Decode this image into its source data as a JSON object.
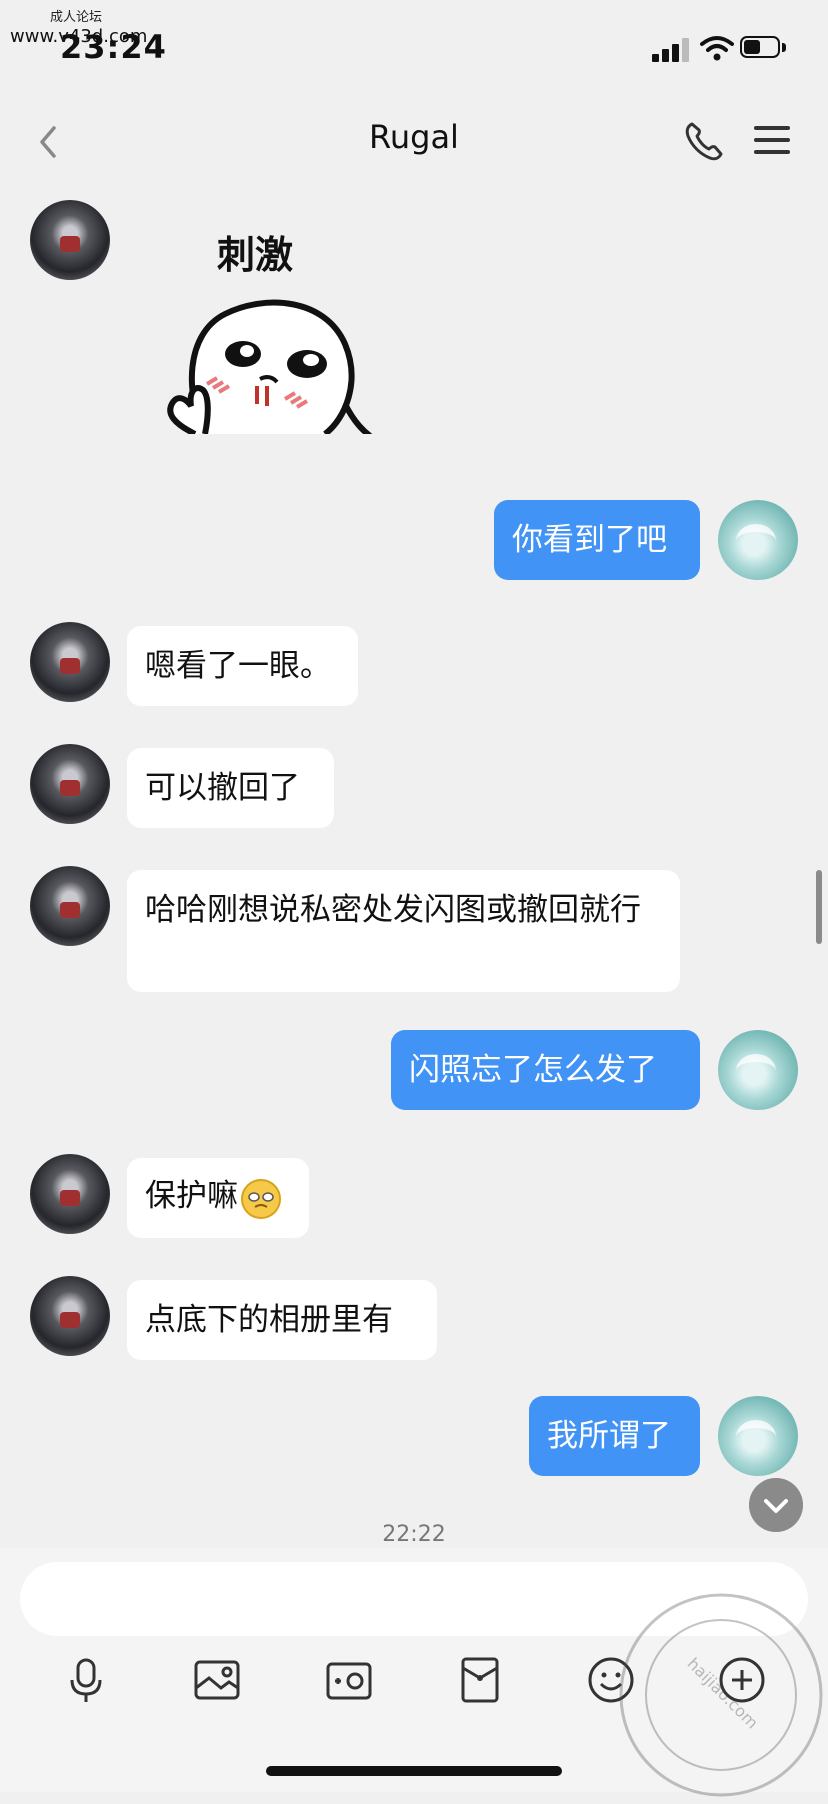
{
  "status_bar": {
    "watermark_site": "成人论坛",
    "watermark_url": "www.v43d.com",
    "time": "23:24"
  },
  "nav": {
    "title": "Rugal",
    "back_icon": "chevron-left-icon",
    "call_icon": "phone-icon",
    "menu_icon": "hamburger-menu-icon"
  },
  "messages": [
    {
      "from": "other",
      "type": "sticker",
      "text": "刺激"
    },
    {
      "from": "me",
      "type": "text",
      "text": "你看到了吧"
    },
    {
      "from": "other",
      "type": "text",
      "text": "嗯看了一眼。"
    },
    {
      "from": "other",
      "type": "text",
      "text": "可以撤回了"
    },
    {
      "from": "other",
      "type": "text",
      "text": "哈哈刚想说私密处发闪图或撤回就行"
    },
    {
      "from": "me",
      "type": "text",
      "text": "闪照忘了怎么发了"
    },
    {
      "from": "other",
      "type": "text",
      "text": "保护嘛",
      "emoji": "sweating-face-emoji"
    },
    {
      "from": "other",
      "type": "text",
      "text": "点底下的相册里有"
    },
    {
      "from": "me",
      "type": "text",
      "text": "我所谓了"
    }
  ],
  "timestamp": "22:22",
  "toolbar": [
    "microphone-icon",
    "photo-album-icon",
    "camera-icon",
    "red-packet-icon",
    "emoji-icon",
    "more-icon"
  ],
  "watermark_bottom": "haijiao.com",
  "colors": {
    "background": "#f0f0f0",
    "my_bubble": "#4193f5",
    "other_bubble": "#ffffff"
  }
}
